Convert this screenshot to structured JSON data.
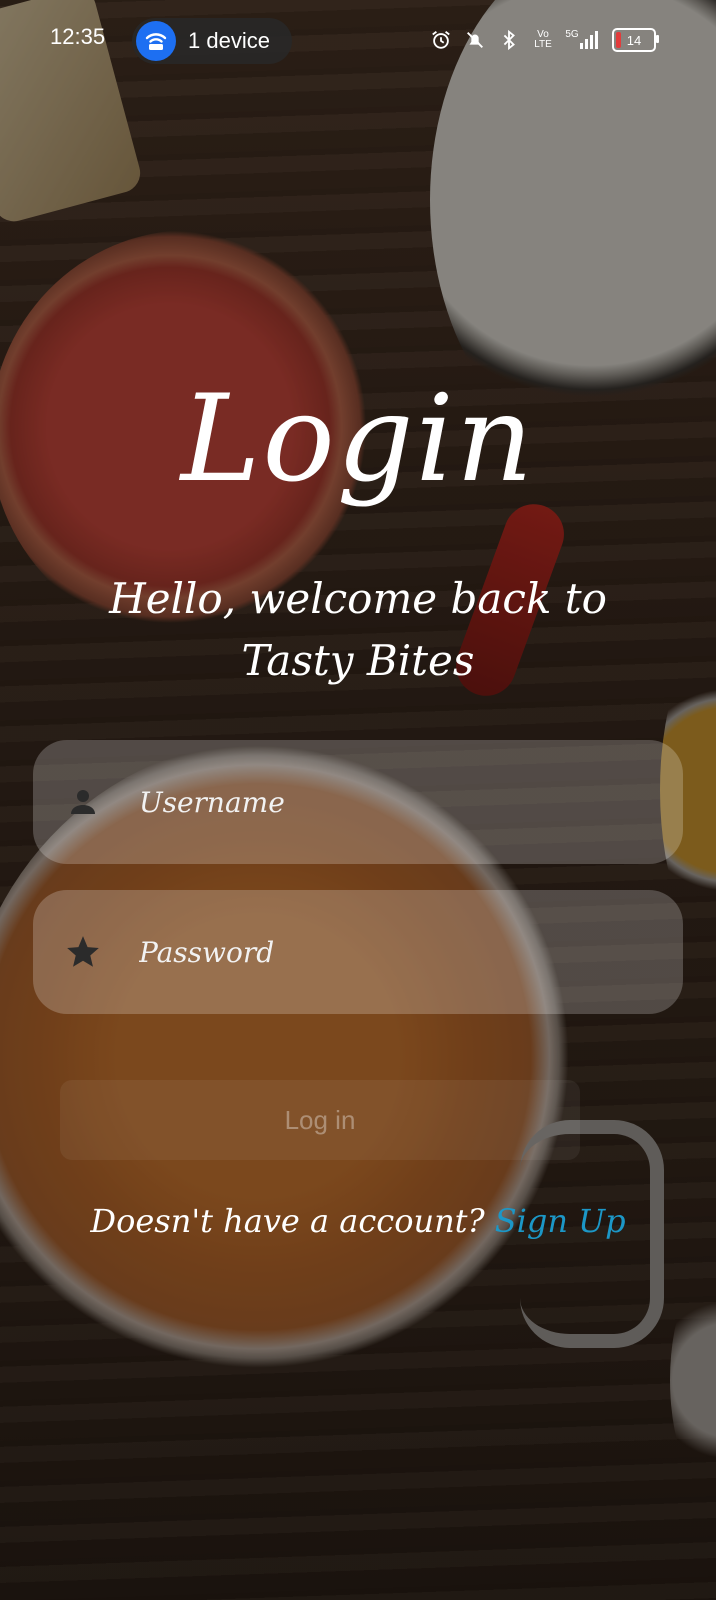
{
  "status_bar": {
    "time": "12:35",
    "device_label": "1 device",
    "battery_level": "14",
    "battery_fraction": 0.14,
    "icons": [
      "alarm-icon",
      "mute-icon",
      "bluetooth-icon",
      "volte-icon",
      "signal-5g-icon",
      "battery-icon"
    ],
    "lte_label": "Vo\nLTE",
    "net_label": "5G"
  },
  "login": {
    "title": "Login",
    "subtitle_line1": "Hello, welcome back to",
    "subtitle_line2": "Tasty Bites",
    "username_placeholder": "Username",
    "password_placeholder": "Password",
    "login_button": "Log in",
    "no_account_text": "Doesn't have a account?",
    "signup_link": "Sign Up"
  },
  "colors": {
    "link": "#1c97c7",
    "device_icon_bg": "#1d6ff2",
    "battery_low": "#e23b3b"
  }
}
